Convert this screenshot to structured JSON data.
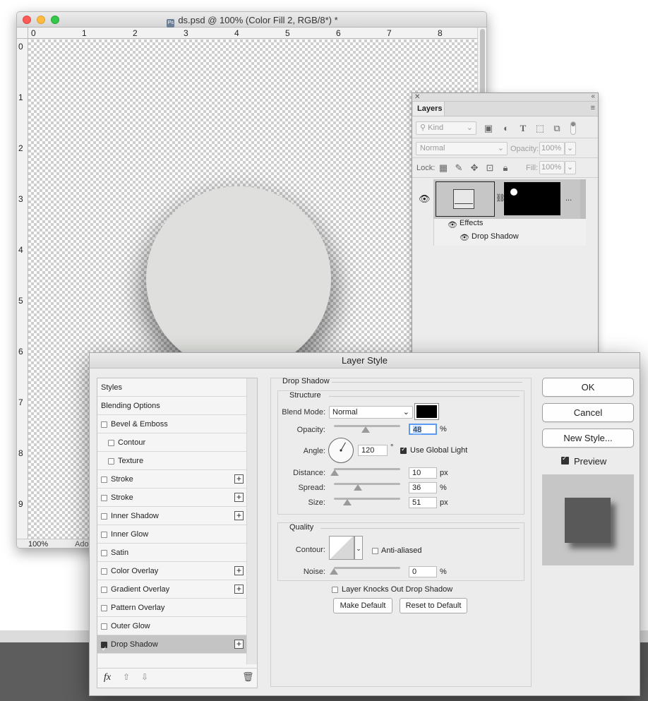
{
  "document": {
    "title": "ds.psd @ 100% (Color Fill 2, RGB/8*) *",
    "ruler_top": [
      "0",
      "1",
      "2",
      "3",
      "4",
      "5",
      "6",
      "7",
      "8"
    ],
    "ruler_left": [
      "0",
      "1",
      "2",
      "3",
      "4",
      "5",
      "6",
      "7",
      "8",
      "9"
    ],
    "zoom": "100%",
    "status_truncated": "Ado"
  },
  "layers_panel": {
    "tab": "Layers",
    "kind_label": "Kind",
    "blend_mode": "Normal",
    "opacity_label": "Opacity:",
    "opacity_value": "100%",
    "lock_label": "Lock:",
    "fill_label": "Fill:",
    "fill_value": "100%",
    "effects_label": "Effects",
    "drop_shadow_label": "Drop Shadow",
    "more": "..."
  },
  "dialog": {
    "title": "Layer Style",
    "styles": [
      {
        "label": "Styles",
        "checkbox": false,
        "plus": false,
        "indent": 0
      },
      {
        "label": "Blending Options",
        "checkbox": false,
        "plus": false,
        "indent": 0
      },
      {
        "label": "Bevel & Emboss",
        "checkbox": true,
        "checked": false,
        "plus": false,
        "indent": 0
      },
      {
        "label": "Contour",
        "checkbox": true,
        "checked": false,
        "plus": false,
        "indent": 1
      },
      {
        "label": "Texture",
        "checkbox": true,
        "checked": false,
        "plus": false,
        "indent": 1
      },
      {
        "label": "Stroke",
        "checkbox": true,
        "checked": false,
        "plus": true,
        "indent": 0
      },
      {
        "label": "Stroke",
        "checkbox": true,
        "checked": false,
        "plus": true,
        "indent": 0
      },
      {
        "label": "Inner Shadow",
        "checkbox": true,
        "checked": false,
        "plus": true,
        "indent": 0
      },
      {
        "label": "Inner Glow",
        "checkbox": true,
        "checked": false,
        "plus": false,
        "indent": 0
      },
      {
        "label": "Satin",
        "checkbox": true,
        "checked": false,
        "plus": false,
        "indent": 0
      },
      {
        "label": "Color Overlay",
        "checkbox": true,
        "checked": false,
        "plus": true,
        "indent": 0
      },
      {
        "label": "Gradient Overlay",
        "checkbox": true,
        "checked": false,
        "plus": true,
        "indent": 0
      },
      {
        "label": "Pattern Overlay",
        "checkbox": true,
        "checked": false,
        "plus": false,
        "indent": 0
      },
      {
        "label": "Outer Glow",
        "checkbox": true,
        "checked": false,
        "plus": false,
        "indent": 0
      },
      {
        "label": "Drop Shadow",
        "checkbox": true,
        "checked": true,
        "plus": true,
        "indent": 0,
        "selected": true
      }
    ],
    "fx_label": "fx",
    "drop_shadow": {
      "section": "Drop Shadow",
      "structure": "Structure",
      "blend_mode_label": "Blend Mode:",
      "blend_mode": "Normal",
      "shadow_color": "#000000",
      "opacity_label": "Opacity:",
      "opacity": "48",
      "angle_label": "Angle:",
      "angle": "120",
      "degree": "°",
      "use_global_light": "Use Global Light",
      "distance_label": "Distance:",
      "distance": "10",
      "spread_label": "Spread:",
      "spread": "36",
      "size_label": "Size:",
      "size": "51",
      "pct": "%",
      "px": "px",
      "quality": "Quality",
      "contour_label": "Contour:",
      "anti_aliased": "Anti-aliased",
      "noise_label": "Noise:",
      "noise": "0",
      "knockout": "Layer Knocks Out Drop Shadow",
      "make_default": "Make Default",
      "reset_default": "Reset to Default"
    },
    "buttons": {
      "ok": "OK",
      "cancel": "Cancel",
      "new_style": "New Style...",
      "preview": "Preview"
    }
  }
}
